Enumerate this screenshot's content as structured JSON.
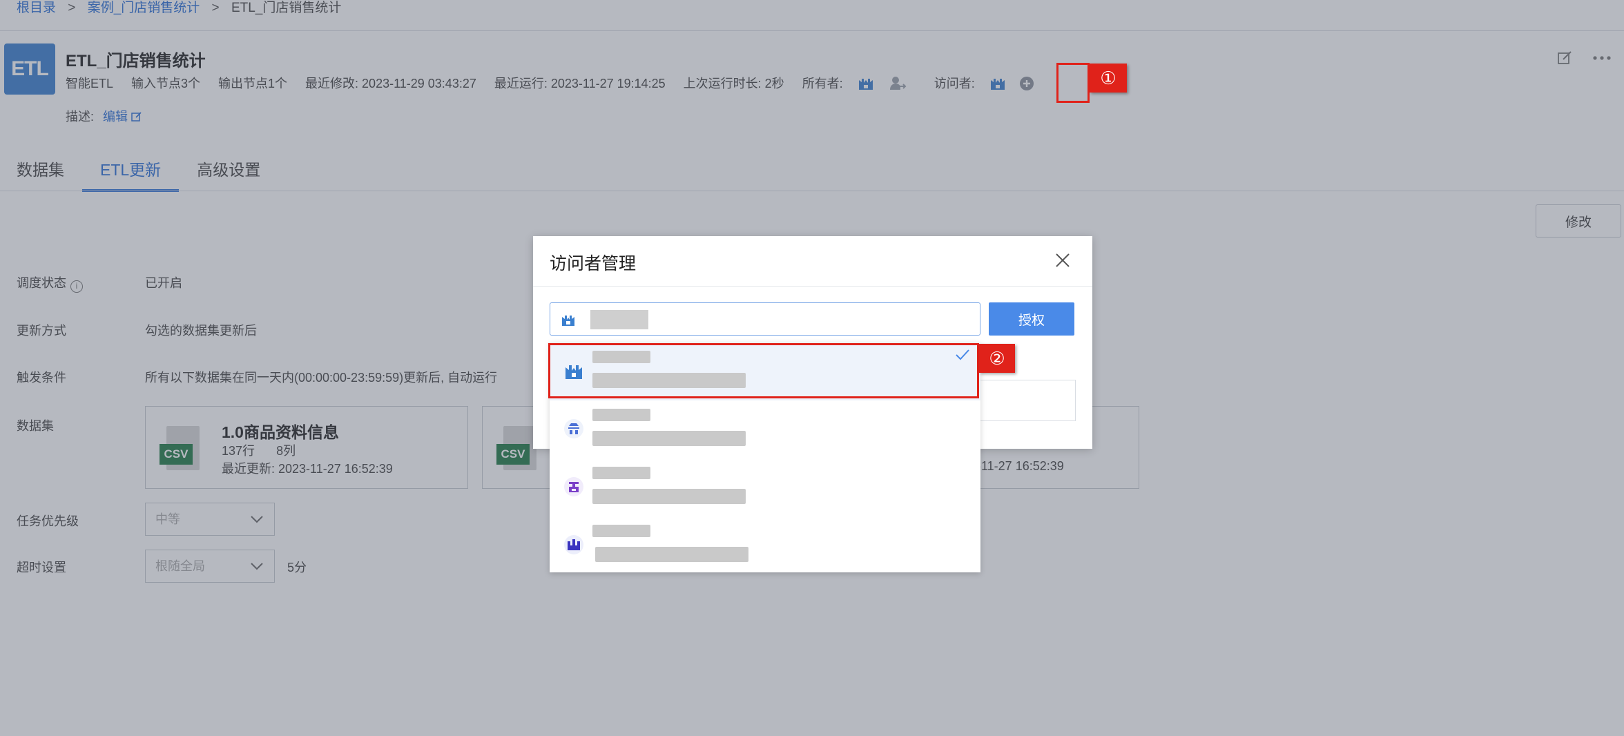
{
  "breadcrumb": {
    "root": "根目录",
    "sep1": ">",
    "case": "案例_门店销售统计",
    "sep2": ">",
    "current": "ETL_门店销售统计"
  },
  "header": {
    "logo_text": "ETL",
    "title": "ETL_门店销售统计",
    "type": "智能ETL",
    "input_nodes": "输入节点3个",
    "output_nodes": "输出节点1个",
    "last_modified": "最近修改: 2023-11-29 03:43:27",
    "last_run": "最近运行: 2023-11-27 19:14:25",
    "last_duration": "上次运行时长: 2秒",
    "owner_label": "所有者:",
    "visitor_label": "访问者:",
    "desc_label": "描述:",
    "desc_edit": "编辑"
  },
  "tabs": [
    {
      "label": "数据集",
      "active": false
    },
    {
      "label": "ETL更新",
      "active": true
    },
    {
      "label": "高级设置",
      "active": false
    }
  ],
  "toolbar": {
    "modify_label": "修改"
  },
  "settings": {
    "schedule_label": "调度状态",
    "schedule_value": "已开启",
    "update_mode_label": "更新方式",
    "update_mode_value": "勾选的数据集更新后",
    "trigger_label": "触发条件",
    "trigger_value": "所有以下数据集在同一天内(00:00:00-23:59:59)更新后, 自动运行",
    "datasets_label": "数据集",
    "priority_label": "任务优先级",
    "priority_value": "中等",
    "timeout_label": "超时设置",
    "timeout_value": "根随全局",
    "timeout_unit": "5分"
  },
  "datasets": [
    {
      "badge": "CSV",
      "name": "1.0商品资料信息",
      "rows": "137行",
      "cols": "8列",
      "updated": "最近更新: 2023-11-27 16:52:39"
    },
    {
      "badge": "CSV",
      "name": "",
      "rows": "",
      "cols": "",
      "updated": ""
    },
    {
      "badge": "",
      "name": "",
      "rows": "",
      "cols": "",
      "updated": "-11-27 16:52:39"
    }
  ],
  "dialog": {
    "title": "访问者管理",
    "auth_button": "授权"
  },
  "callouts": {
    "one": "①",
    "two": "②"
  },
  "colors": {
    "accent": "#2a6fd6",
    "button_primary": "#4a8ae8",
    "callout_red": "#e0221a",
    "csv_green": "#1f7b45",
    "logo_blue": "#3a7fcf"
  },
  "icons": [
    "edit-icon",
    "more-icon",
    "info-icon",
    "close-icon",
    "check-icon",
    "chevron-down-icon",
    "person-icon",
    "transfer-owner-icon",
    "add-circle-icon",
    "department-icon",
    "role-icon",
    "group-icon"
  ]
}
